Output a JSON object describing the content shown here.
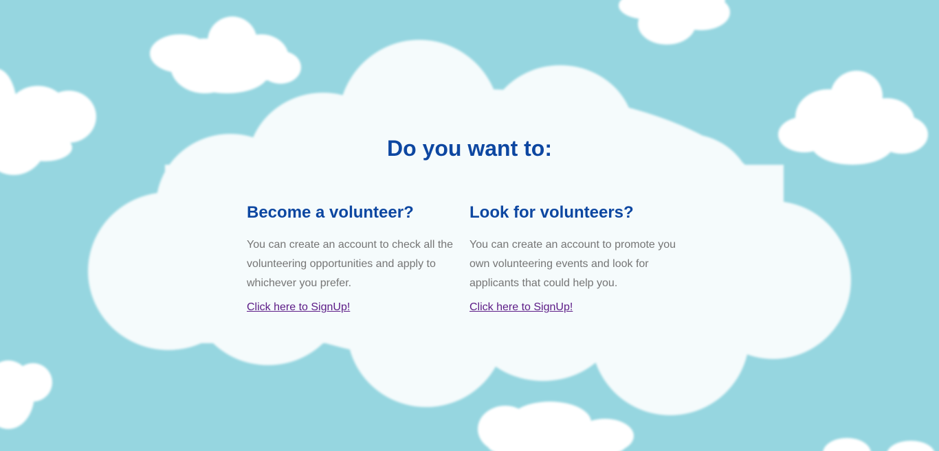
{
  "page": {
    "headline": "Do you want to:"
  },
  "options": [
    {
      "title": "Become a volunteer?",
      "description": "You can create an account to check all the volunteering opportunities and apply to whichever you prefer.",
      "link_label": "Click here to SignUp!"
    },
    {
      "title": "Look for volunteers?",
      "description": "You can create an account to promote you own volunteering events and look for applicants that could help you.",
      "link_label": "Click here to SignUp!"
    }
  ],
  "colors": {
    "sky": "#96d6e0",
    "cloud": "#ffffff",
    "main_cloud": "#f5fbfc",
    "heading": "#0d47a1",
    "body_text": "#757575",
    "link": "#5b1a86"
  }
}
